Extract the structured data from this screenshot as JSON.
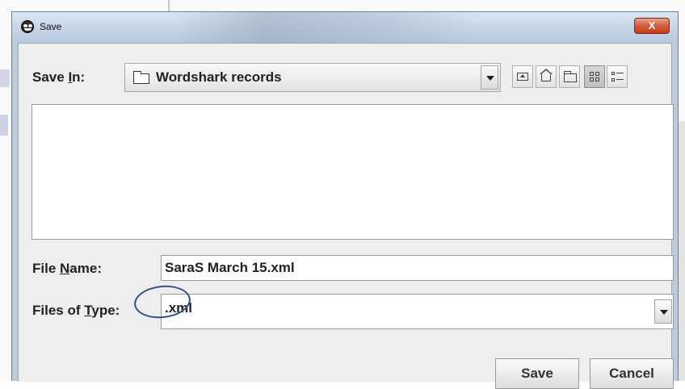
{
  "window": {
    "title": "Save",
    "close_label": "X"
  },
  "save_in": {
    "label_pre": "Save ",
    "label_key": "I",
    "label_post": "n:",
    "value": "Wordshark records"
  },
  "toolbar": {
    "icons": [
      "up-one-level-icon",
      "home-icon",
      "new-folder-icon",
      "list-view-icon",
      "details-view-icon"
    ],
    "selected_view": "list"
  },
  "file_name": {
    "label_pre": "File ",
    "label_key": "N",
    "label_post": "ame:",
    "value": "SaraS March 15.xml"
  },
  "files_of_type": {
    "label_pre": "Files of ",
    "label_key": "T",
    "label_post": "ype:",
    "value": ".xml"
  },
  "buttons": {
    "save": "Save",
    "cancel": "Cancel"
  },
  "colors": {
    "annotation_circle": "#2f5486",
    "close_button": "#c8472a"
  }
}
